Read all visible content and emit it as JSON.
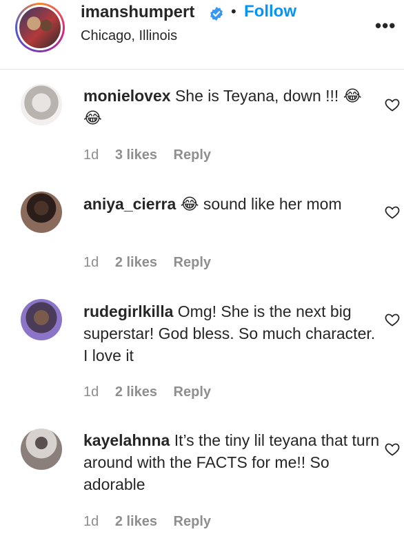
{
  "post": {
    "username": "imanshumpert",
    "separator": "•",
    "follow_label": "Follow",
    "location": "Chicago, Illinois",
    "more_icon": "•••"
  },
  "comments": [
    {
      "username": "monielovex",
      "text": "She is Teyana, down !!! 😂😂",
      "time": "1d",
      "likes": "3 likes",
      "reply": "Reply"
    },
    {
      "username": "aniya_cierra",
      "text": "😂 sound like her mom",
      "time": "1d",
      "likes": "2 likes",
      "reply": "Reply"
    },
    {
      "username": "rudegirlkilla",
      "text": "Omg! She is the next big superstar! God bless. So much character. I love it",
      "time": "1d",
      "likes": "2 likes",
      "reply": "Reply"
    },
    {
      "username": "kayelahnna",
      "text": "It’s the tiny lil teyana that turn around with the FACTS for me!! So adorable",
      "time": "1d",
      "likes": "2 likes",
      "reply": "Reply"
    }
  ],
  "colors": {
    "follow": "#0095f6",
    "verified": "#3897f0",
    "meta": "#8e8e8e"
  }
}
